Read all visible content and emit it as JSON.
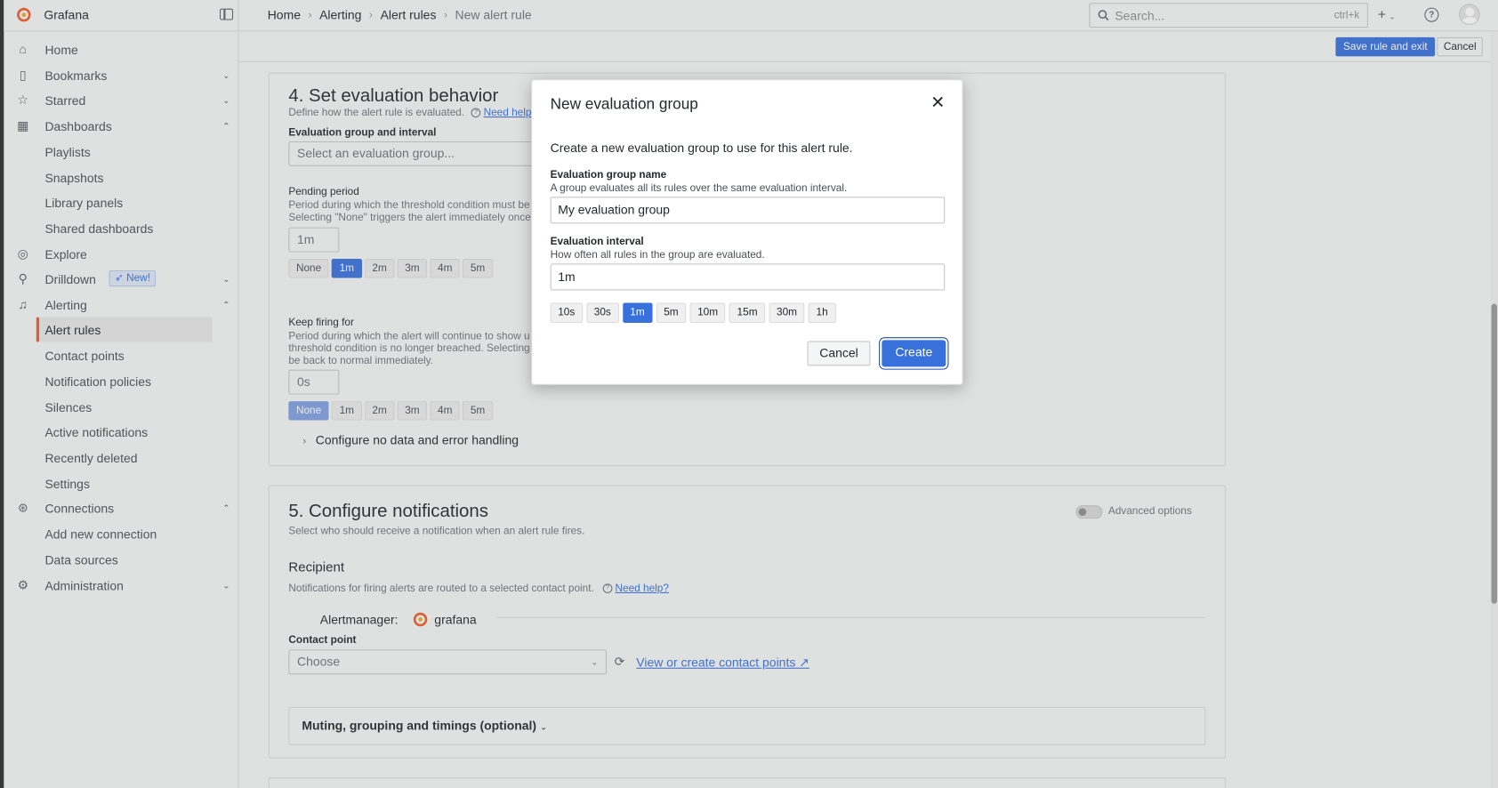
{
  "app": {
    "name": "Grafana"
  },
  "breadcrumb": [
    "Home",
    "Alerting",
    "Alert rules",
    "New alert rule"
  ],
  "search": {
    "placeholder": "Search...",
    "shortcut": "ctrl+k"
  },
  "actions": {
    "save": "Save rule and exit",
    "cancel": "Cancel"
  },
  "sidebar": {
    "items": [
      {
        "label": "Home",
        "icon": "home-icon"
      },
      {
        "label": "Bookmarks",
        "icon": "bookmark-icon"
      },
      {
        "label": "Starred",
        "icon": "star-icon"
      },
      {
        "label": "Dashboards",
        "icon": "apps-icon"
      },
      {
        "label": "Playlists"
      },
      {
        "label": "Snapshots"
      },
      {
        "label": "Library panels"
      },
      {
        "label": "Shared dashboards"
      },
      {
        "label": "Explore",
        "icon": "compass-icon"
      },
      {
        "label": "Drilldown",
        "icon": "drilldown-icon",
        "badge": "New!"
      },
      {
        "label": "Alerting",
        "icon": "bell-icon"
      },
      {
        "label": "Alert rules"
      },
      {
        "label": "Contact points"
      },
      {
        "label": "Notification policies"
      },
      {
        "label": "Silences"
      },
      {
        "label": "Active notifications"
      },
      {
        "label": "Recently deleted"
      },
      {
        "label": "Settings"
      },
      {
        "label": "Connections",
        "icon": "connections-icon"
      },
      {
        "label": "Add new connection"
      },
      {
        "label": "Data sources"
      },
      {
        "label": "Administration",
        "icon": "cog-icon"
      }
    ]
  },
  "section4": {
    "title": "4. Set evaluation behavior",
    "desc": "Define how the alert rule is evaluated.",
    "help": "Need help?",
    "group_label": "Evaluation group and interval",
    "group_placeholder": "Select an evaluation group...",
    "pending_label": "Pending period",
    "pending_desc1": "Period during which the threshold condition must be",
    "pending_desc2": "Selecting \"None\" triggers the alert immediately once",
    "pending_value": "1m",
    "pending_options": [
      "None",
      "1m",
      "2m",
      "3m",
      "4m",
      "5m"
    ],
    "pending_selected": "1m",
    "keep_label": "Keep firing for",
    "keep_desc1": "Period during which the alert will continue to show u",
    "keep_desc2": "threshold condition is no longer breached. Selecting",
    "keep_desc3": "be back to normal immediately.",
    "keep_value": "0s",
    "keep_options": [
      "None",
      "1m",
      "2m",
      "3m",
      "4m",
      "5m"
    ],
    "keep_selected": "None",
    "nodata": "Configure no data and error handling"
  },
  "section5": {
    "title": "5. Configure notifications",
    "desc": "Select who should receive a notification when an alert rule fires.",
    "advanced": "Advanced options",
    "recipient": "Recipient",
    "recipient_desc": "Notifications for firing alerts are routed to a selected contact point.",
    "help": "Need help?",
    "alertmanager_label": "Alertmanager:",
    "alertmanager_value": "grafana",
    "contact_label": "Contact point",
    "contact_placeholder": "Choose",
    "contact_link": "View or create contact points",
    "muting": "Muting, grouping and timings (optional)"
  },
  "modal": {
    "title": "New evaluation group",
    "intro": "Create a new evaluation group to use for this alert rule.",
    "name_label": "Evaluation group name",
    "name_desc": "A group evaluates all its rules over the same evaluation interval.",
    "name_value": "My evaluation group",
    "interval_label": "Evaluation interval",
    "interval_desc": "How often all rules in the group are evaluated.",
    "interval_value": "1m",
    "interval_options": [
      "10s",
      "30s",
      "1m",
      "5m",
      "10m",
      "15m",
      "30m",
      "1h"
    ],
    "interval_selected": "1m",
    "cancel": "Cancel",
    "create": "Create"
  },
  "colors": {
    "primary": "#3871dc",
    "brand": "#f05a28"
  }
}
